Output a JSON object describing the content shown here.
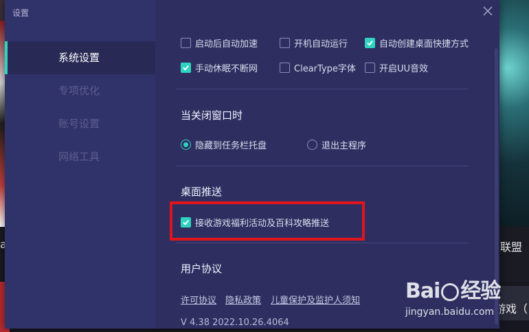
{
  "background": {
    "right_label": "联盟",
    "right_game_label": "游戏（",
    "left_label": "a"
  },
  "dialog": {
    "title": "设置",
    "sidebar": {
      "items": [
        {
          "label": "系统设置",
          "active": true
        },
        {
          "label": "专项优化",
          "active": false
        },
        {
          "label": "账号设置",
          "active": false
        },
        {
          "label": "网络工具",
          "active": false
        }
      ]
    },
    "general_options": [
      {
        "label": "启动后自动加速",
        "checked": false
      },
      {
        "label": "开机自动运行",
        "checked": false
      },
      {
        "label": "自动创建桌面快捷方式",
        "checked": true
      },
      {
        "label": "手动休眠不断网",
        "checked": true
      },
      {
        "label": "ClearType字体",
        "checked": false
      },
      {
        "label": "开启UU音效",
        "checked": false
      }
    ],
    "close_section": {
      "title": "当关闭窗口时",
      "options": [
        {
          "label": "隐藏到任务栏托盘",
          "selected": true
        },
        {
          "label": "退出主程序",
          "selected": false
        }
      ]
    },
    "push_section": {
      "title": "桌面推送",
      "option": {
        "label": "接收游戏福利活动及百科攻略推送",
        "checked": true
      }
    },
    "agreement_section": {
      "title": "用户协议",
      "links": [
        "许可协议",
        "隐私政策",
        "儿童保护及监护人须知"
      ],
      "version": "V 4.38 2022.10.26.4064"
    }
  },
  "watermark": {
    "logo_a": "Bai",
    "logo_b": "经验",
    "url": "jingyan.baidu.com"
  },
  "colors": {
    "accent": "#2fd3c0",
    "dialog_bg": "#2e2f60",
    "sidebar_bg": "#30326a",
    "highlight": "#e0151b"
  }
}
